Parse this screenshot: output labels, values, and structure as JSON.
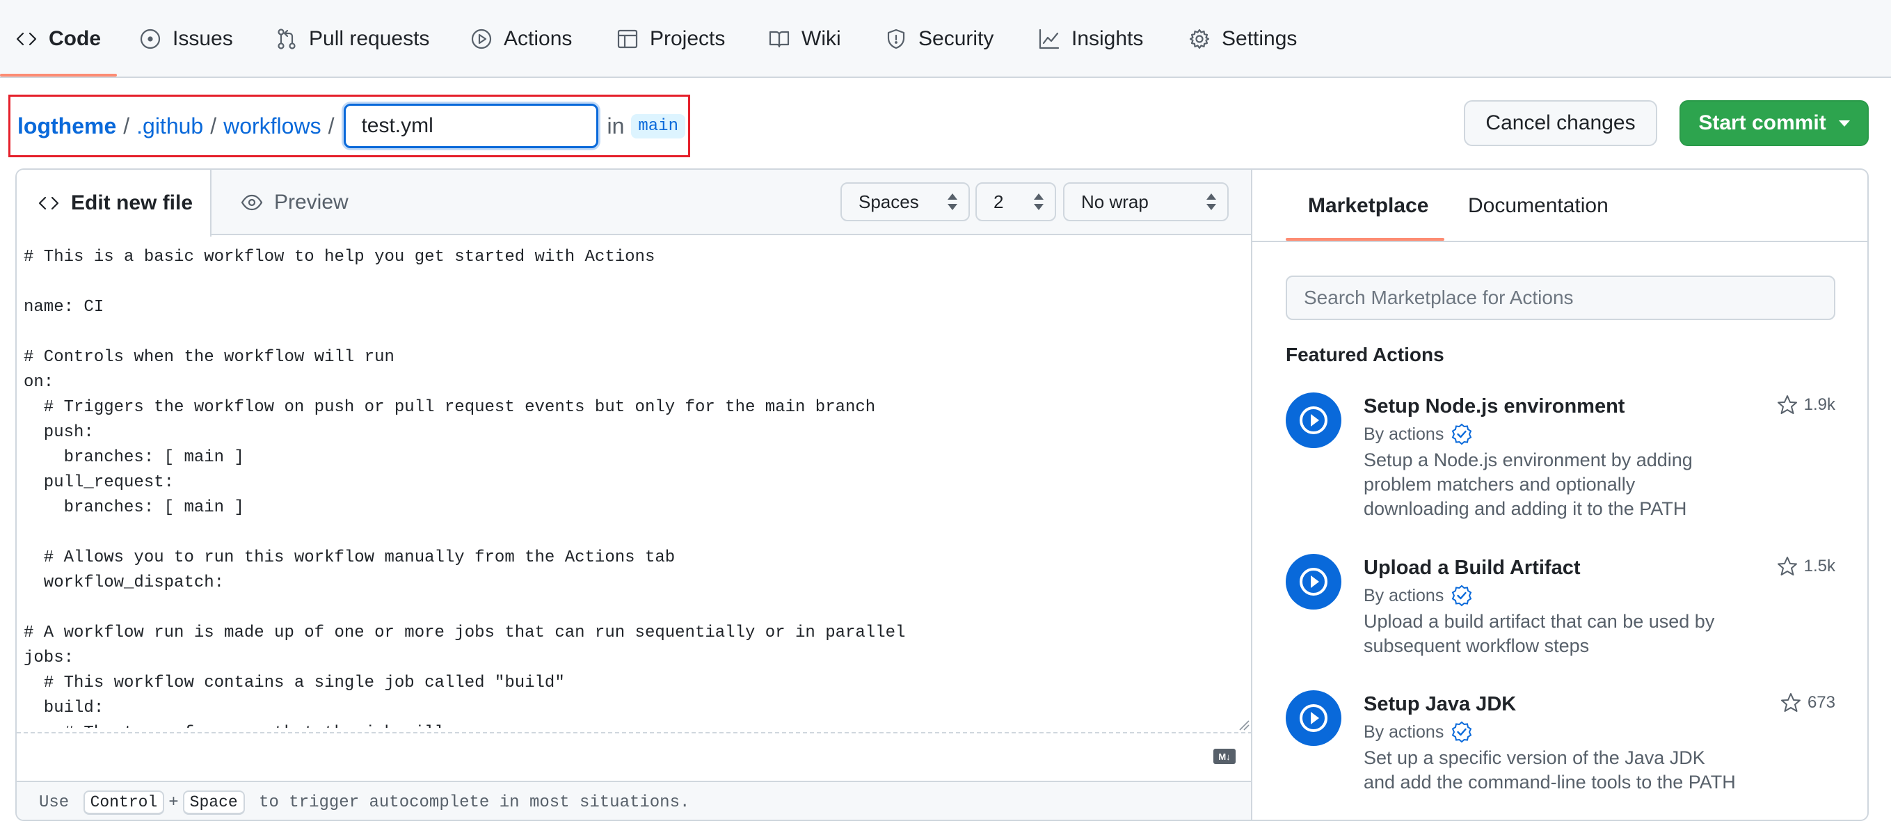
{
  "repo_nav": {
    "items": [
      {
        "label": "Code",
        "icon": "code-icon",
        "selected": true
      },
      {
        "label": "Issues",
        "icon": "issue-icon",
        "selected": false
      },
      {
        "label": "Pull requests",
        "icon": "pull-request-icon",
        "selected": false
      },
      {
        "label": "Actions",
        "icon": "play-icon",
        "selected": false
      },
      {
        "label": "Projects",
        "icon": "table-icon",
        "selected": false
      },
      {
        "label": "Wiki",
        "icon": "book-icon",
        "selected": false
      },
      {
        "label": "Security",
        "icon": "shield-icon",
        "selected": false
      },
      {
        "label": "Insights",
        "icon": "graph-icon",
        "selected": false
      },
      {
        "label": "Settings",
        "icon": "gear-icon",
        "selected": false
      }
    ]
  },
  "path": {
    "owner": "logtheme",
    "sep": "/",
    "folders": [
      ".github",
      "workflows"
    ],
    "filename": "test.yml",
    "in_label": "in",
    "branch": "main"
  },
  "actions": {
    "cancel_label": "Cancel changes",
    "commit_label": "Start commit"
  },
  "editor": {
    "tab_edit": "Edit new file",
    "tab_preview": "Preview",
    "indent_mode": "Spaces",
    "indent_size": "2",
    "wrap_mode": "No wrap",
    "lines": [
      "# This is a basic workflow to help you get started with Actions",
      "",
      "name: CI",
      "",
      "# Controls when the workflow will run",
      "on:",
      "  # Triggers the workflow on push or pull request events but only for the main branch",
      "  push:",
      "    branches: [ main ]",
      "  pull_request:",
      "    branches: [ main ]",
      "",
      "  # Allows you to run this workflow manually from the Actions tab",
      "  workflow_dispatch:",
      "",
      "# A workflow run is made up of one or more jobs that can run sequentially or in parallel",
      "jobs:",
      "  # This workflow contains a single job called \"build\"",
      "  build:",
      "    # The type of runner that the job will run on"
    ],
    "footer": {
      "use": "Use",
      "key1": "Control",
      "plus": "+",
      "key2": "Space",
      "rest": "to trigger autocomplete in most situations."
    },
    "markdown_badge": "M↓"
  },
  "sidebar": {
    "tab_marketplace": "Marketplace",
    "tab_documentation": "Documentation",
    "search_placeholder": "Search Marketplace for Actions",
    "featured_title": "Featured Actions",
    "actions": [
      {
        "title": "Setup Node.js environment",
        "by": "By actions",
        "description": "Setup a Node.js environment by adding problem matchers and optionally downloading and adding it to the PATH",
        "stars": "1.9k"
      },
      {
        "title": "Upload a Build Artifact",
        "by": "By actions",
        "description": "Upload a build artifact that can be used by subsequent workflow steps",
        "stars": "1.5k"
      },
      {
        "title": "Setup Java JDK",
        "by": "By actions",
        "description": "Set up a specific version of the Java JDK and add the command-line tools to the PATH",
        "stars": "673"
      }
    ]
  },
  "colors": {
    "accent_blue": "#0969da",
    "commit_green": "#2da44e",
    "tab_underline": "#fd8c73",
    "highlight_red": "#e5202b"
  }
}
